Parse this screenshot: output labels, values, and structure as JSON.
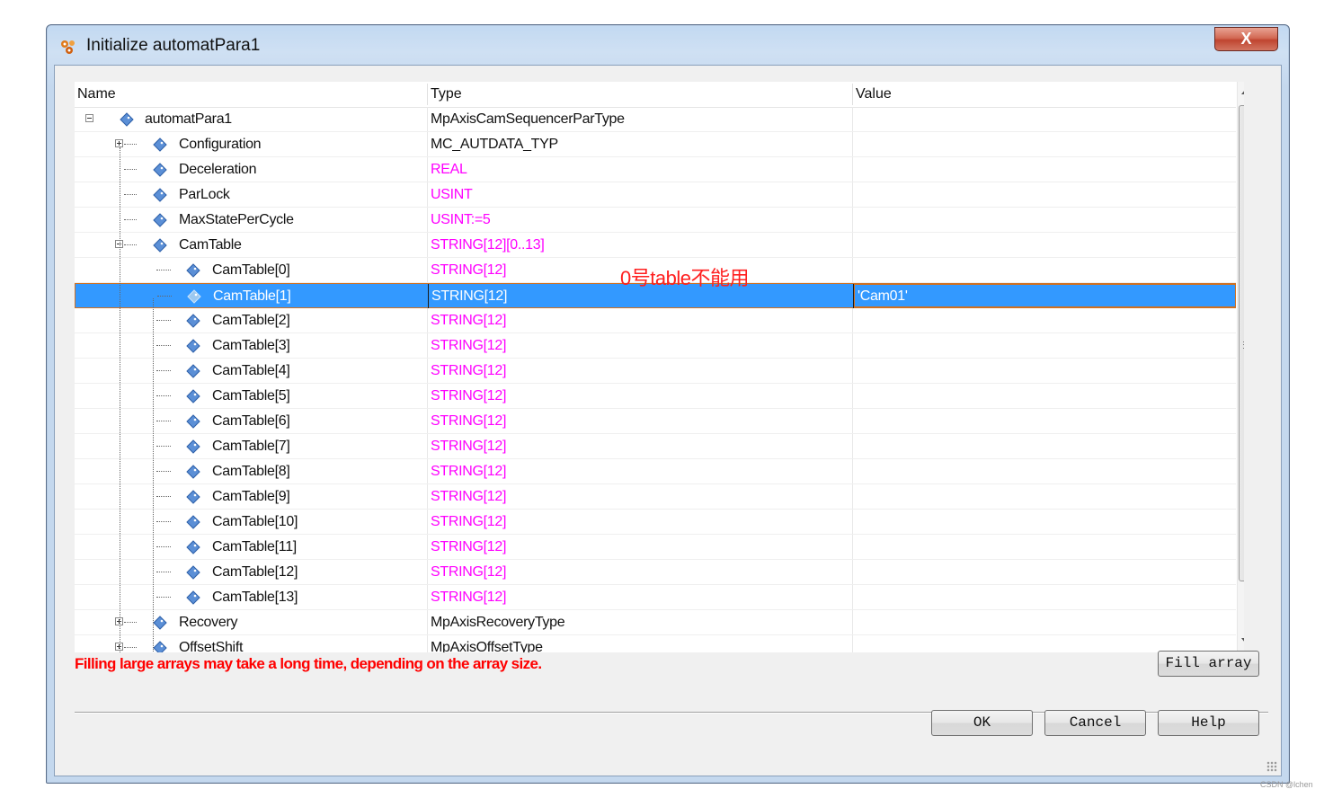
{
  "window": {
    "title": "Initialize automatPara1",
    "close_label": "X"
  },
  "columns": {
    "name": "Name",
    "type": "Type",
    "value": "Value"
  },
  "rows": [
    {
      "name": "automatPara1",
      "type": "MpAxisCamSequencerParType",
      "value": "",
      "level": 0,
      "expander": "minus",
      "type_color": "black"
    },
    {
      "name": "Configuration",
      "type": "MC_AUTDATA_TYP",
      "value": "",
      "level": 1,
      "expander": "plus",
      "type_color": "black"
    },
    {
      "name": "Deceleration",
      "type": "REAL",
      "value": "",
      "level": 1,
      "expander": "none",
      "type_color": "magenta"
    },
    {
      "name": "ParLock",
      "type": "USINT",
      "value": "",
      "level": 1,
      "expander": "none",
      "type_color": "magenta"
    },
    {
      "name": "MaxStatePerCycle",
      "type": "USINT:=5",
      "value": "",
      "level": 1,
      "expander": "none",
      "type_color": "magenta"
    },
    {
      "name": "CamTable",
      "type": "STRING[12][0..13]",
      "value": "",
      "level": 1,
      "expander": "minus",
      "type_color": "magenta"
    },
    {
      "name": "CamTable[0]",
      "type": "STRING[12]",
      "value": "",
      "level": 2,
      "expander": "none",
      "type_color": "magenta"
    },
    {
      "name": "CamTable[1]",
      "type": "STRING[12]",
      "value": "'Cam01'",
      "level": 2,
      "expander": "none",
      "type_color": "magenta",
      "selected": true
    },
    {
      "name": "CamTable[2]",
      "type": "STRING[12]",
      "value": "",
      "level": 2,
      "expander": "none",
      "type_color": "magenta"
    },
    {
      "name": "CamTable[3]",
      "type": "STRING[12]",
      "value": "",
      "level": 2,
      "expander": "none",
      "type_color": "magenta"
    },
    {
      "name": "CamTable[4]",
      "type": "STRING[12]",
      "value": "",
      "level": 2,
      "expander": "none",
      "type_color": "magenta"
    },
    {
      "name": "CamTable[5]",
      "type": "STRING[12]",
      "value": "",
      "level": 2,
      "expander": "none",
      "type_color": "magenta"
    },
    {
      "name": "CamTable[6]",
      "type": "STRING[12]",
      "value": "",
      "level": 2,
      "expander": "none",
      "type_color": "magenta"
    },
    {
      "name": "CamTable[7]",
      "type": "STRING[12]",
      "value": "",
      "level": 2,
      "expander": "none",
      "type_color": "magenta"
    },
    {
      "name": "CamTable[8]",
      "type": "STRING[12]",
      "value": "",
      "level": 2,
      "expander": "none",
      "type_color": "magenta"
    },
    {
      "name": "CamTable[9]",
      "type": "STRING[12]",
      "value": "",
      "level": 2,
      "expander": "none",
      "type_color": "magenta"
    },
    {
      "name": "CamTable[10]",
      "type": "STRING[12]",
      "value": "",
      "level": 2,
      "expander": "none",
      "type_color": "magenta"
    },
    {
      "name": "CamTable[11]",
      "type": "STRING[12]",
      "value": "",
      "level": 2,
      "expander": "none",
      "type_color": "magenta"
    },
    {
      "name": "CamTable[12]",
      "type": "STRING[12]",
      "value": "",
      "level": 2,
      "expander": "none",
      "type_color": "magenta"
    },
    {
      "name": "CamTable[13]",
      "type": "STRING[12]",
      "value": "",
      "level": 2,
      "expander": "none",
      "type_color": "magenta"
    },
    {
      "name": "Recovery",
      "type": "MpAxisRecoveryType",
      "value": "",
      "level": 1,
      "expander": "plus",
      "type_color": "black"
    },
    {
      "name": "OffsetShift",
      "type": "MpAxisOffsetType",
      "value": "",
      "level": 1,
      "expander": "plus",
      "type_color": "black"
    }
  ],
  "annotation": "0号table不能用",
  "warning": "Filling large arrays may take a long time, depending on the array size.",
  "buttons": {
    "fill_array": "Fill array",
    "ok": "OK",
    "cancel": "Cancel",
    "help": "Help"
  },
  "watermark": "CSDN @lchen",
  "colors": {
    "selection": "#3399ff",
    "type_magenta": "#ff00ff",
    "warning": "#ff0000",
    "annotation": "#ff2020"
  },
  "icons": {
    "app": "gear-cluster-icon",
    "node": "tag-diamond-icon"
  }
}
